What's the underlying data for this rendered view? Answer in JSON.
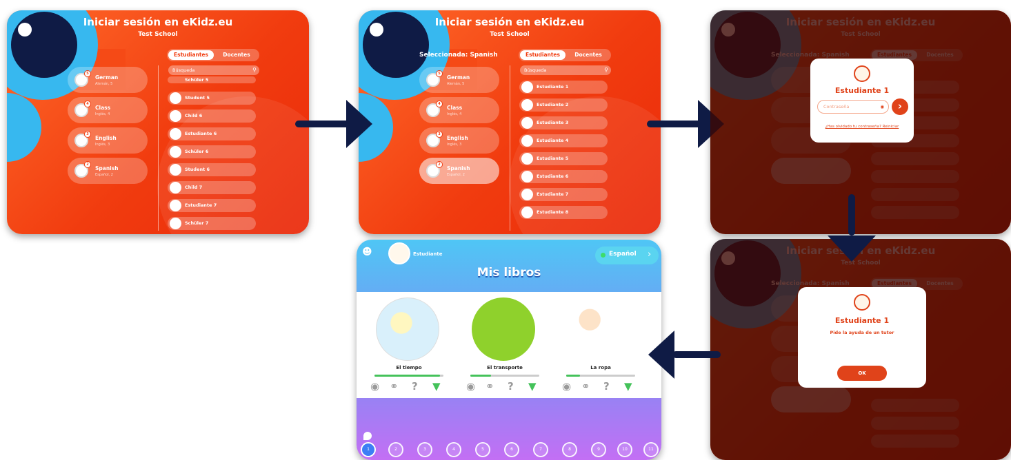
{
  "login": {
    "title": "Iniciar sesión en eKidz.eu",
    "school": "Test School",
    "selected": "Seleccionada: Spanish",
    "tabs": [
      "Estudiantes",
      "Docentes"
    ],
    "search_placeholder": "Búsqueda"
  },
  "classes": [
    {
      "name": "German",
      "info": "Alemán, 5",
      "count": "5"
    },
    {
      "name": "Class",
      "info": "Inglés, 4",
      "count": "4"
    },
    {
      "name": "English",
      "info": "Inglés, 3",
      "count": "3"
    },
    {
      "name": "Spanish",
      "info": "Español, 2",
      "count": "2"
    }
  ],
  "all_students": [
    "Schüler 5",
    "Student 5",
    "Child 6",
    "Estudiante 6",
    "Schüler 6",
    "Student 6",
    "Child 7",
    "Estudiante 7",
    "Schüler 7"
  ],
  "spanish_students": [
    "Estudiante 1",
    "Estudiante 2",
    "Estudiante 3",
    "Estudiante 4",
    "Estudiante 5",
    "Estudiante 6",
    "Estudiante 7",
    "Estudiante 8"
  ],
  "password_dialog": {
    "name": "Estudiante 1",
    "placeholder": "Contraseña",
    "forgot_link": "¿Has olvidado tu contraseña? Reiniciar"
  },
  "help_dialog": {
    "name": "Estudiante 1",
    "message": "Pide la ayuda de un tutor",
    "ok": "OK"
  },
  "books_screen": {
    "user": "Estudiante",
    "language": "Español",
    "title": "Mis libros",
    "books": [
      {
        "title": "El tiempo",
        "progress": 0.95
      },
      {
        "title": "El transporte",
        "progress": 0.3
      },
      {
        "title": "La ropa",
        "progress": 0.2
      }
    ],
    "pages": [
      "1",
      "2",
      "3",
      "4",
      "5",
      "6",
      "7",
      "8",
      "9",
      "10",
      "11"
    ]
  },
  "colors": {
    "accent": "#f13c0f",
    "navy": "#0f1b45",
    "sky": "#37b8ef"
  },
  "icons": [
    "eye-icon",
    "headphones-icon",
    "question-icon",
    "microphone-icon",
    "search-icon",
    "arrow-right-icon",
    "location-pin-icon",
    "parent-icon"
  ]
}
